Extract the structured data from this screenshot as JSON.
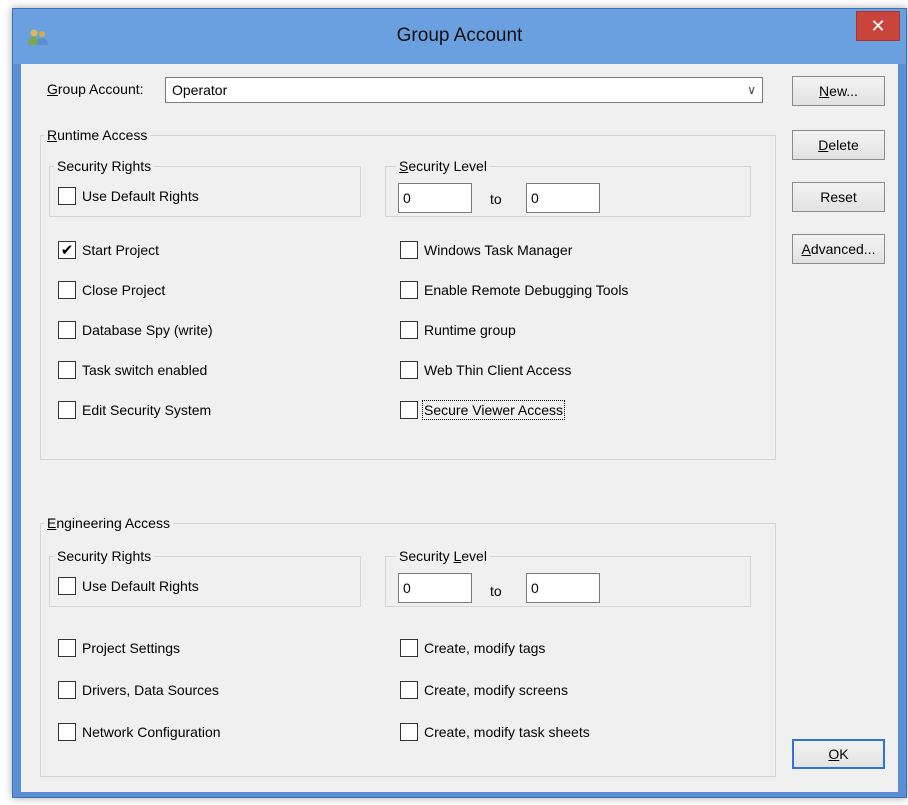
{
  "window": {
    "title": "Group Account",
    "close_glyph": "✕",
    "title_icon": "users-icon"
  },
  "header": {
    "group_account_label": "Group Account:",
    "group_account_value": "Operator",
    "dropdown_glyph": "∨"
  },
  "buttons": {
    "new": "New...",
    "delete": "Delete",
    "reset": "Reset",
    "advanced": "Advanced...",
    "ok": "OK"
  },
  "runtime": {
    "title": "Runtime Access",
    "security_rights_title": "Security Rights",
    "use_default_rights": "Use Default Rights",
    "security_level_title": "Security Level",
    "level_from": "0",
    "level_to_label": "to",
    "level_to": "0",
    "left_items": [
      {
        "label": "Start Project",
        "checked": true
      },
      {
        "label": "Close Project",
        "checked": false
      },
      {
        "label": "Database Spy (write)",
        "checked": false
      },
      {
        "label": "Task switch enabled",
        "checked": false
      },
      {
        "label": "Edit Security System",
        "checked": false
      }
    ],
    "right_items": [
      {
        "label": "Windows Task Manager",
        "checked": false
      },
      {
        "label": "Enable Remote Debugging Tools",
        "checked": false
      },
      {
        "label": "Runtime group",
        "checked": false
      },
      {
        "label": "Web Thin Client Access",
        "checked": false
      },
      {
        "label": "Secure Viewer Access",
        "checked": false
      }
    ]
  },
  "engineering": {
    "title": "Engineering Access",
    "security_rights_title": "Security Rights",
    "use_default_rights": "Use Default Rights",
    "security_level_title": "Security Level",
    "level_from": "0",
    "level_to_label": "to",
    "level_to": "0",
    "left_items": [
      {
        "label": "Project Settings",
        "checked": false
      },
      {
        "label": "Drivers, Data Sources",
        "checked": false
      },
      {
        "label": "Network Configuration",
        "checked": false
      }
    ],
    "right_items": [
      {
        "label": "Create, modify tags",
        "checked": false
      },
      {
        "label": "Create, modify screens",
        "checked": false
      },
      {
        "label": "Create, modify task sheets",
        "checked": false
      }
    ]
  },
  "colors": {
    "title_bar": "#6a9fe0",
    "close_button": "#c9443a",
    "dialog_bg": "#f0f0f0",
    "focus_border": "#2f74d0"
  }
}
